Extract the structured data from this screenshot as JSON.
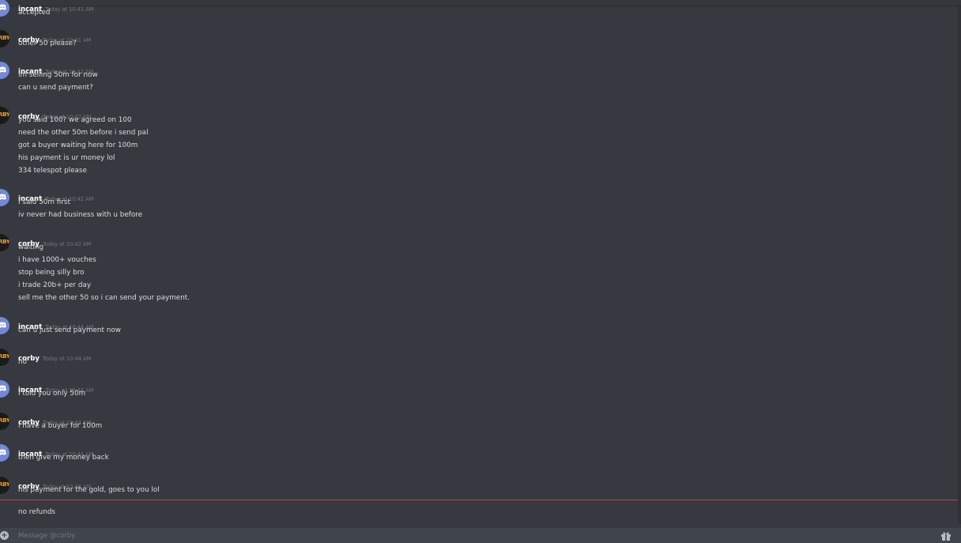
{
  "channel": {
    "composer_placeholder": "Message @corby",
    "composer_value": ""
  },
  "icons": {
    "incant_avatar": "discord-logo-icon",
    "corby_avatar": "corby-avatar-icon",
    "attach": "plus-circle-icon",
    "gift": "gift-icon"
  },
  "colors": {
    "background": "#36393f",
    "discord_blurple": "#7289da",
    "new_messages_divider": "#d83c3e",
    "corby_avatar_text": "#f0a22a"
  },
  "messages": [
    {
      "author": "incant",
      "time": "Today at 10:41 AM",
      "lines": [
        "accepted"
      ]
    },
    {
      "author": "corby",
      "time": "Today at 10:41 AM",
      "lines": [
        "other 50 please?"
      ]
    },
    {
      "author": "incant",
      "time": "Today at 10:42 AM",
      "lines": [
        "im selling 50m for now",
        "can u send payment?"
      ]
    },
    {
      "author": "corby",
      "time": "Today at 10:42 AM",
      "lines": [
        "you said 100? we agreed on 100",
        "need the other 50m before i send pal",
        "got a buyer waiting here for 100m",
        "his payment is ur money lol",
        "334 telespot please"
      ]
    },
    {
      "author": "incant",
      "time": "Today at 10:42 AM",
      "lines": [
        "I said 50m first",
        "iv never had business with u before"
      ]
    },
    {
      "author": "corby",
      "time": "Today at 10:42 AM",
      "lines": [
        "waiting",
        "i have 1000+ vouches",
        "stop being silly bro",
        "i trade 20b+ per day",
        "sell me the other 50 so i can send your payment."
      ]
    },
    {
      "author": "incant",
      "time": "Today at 10:44 AM",
      "lines": [
        "can u just send payment now"
      ]
    },
    {
      "author": "corby",
      "time": "Today at 10:44 AM",
      "lines": [
        "no"
      ]
    },
    {
      "author": "incant",
      "time": "Today at 10:44 AM",
      "lines": [
        "I told you only 50m"
      ]
    },
    {
      "author": "corby",
      "time": "Today at 10:44 AM",
      "lines": [
        "i have a buyer for 100m"
      ]
    },
    {
      "author": "incant",
      "time": "Today at 10:44 AM",
      "lines": [
        "then give my money back"
      ]
    },
    {
      "author": "corby",
      "time": "Today at 10:44 AM",
      "lines": [
        "his payment for the gold, goes to you lol",
        "no refunds"
      ]
    }
  ],
  "corby_avatar_text": "RBY"
}
